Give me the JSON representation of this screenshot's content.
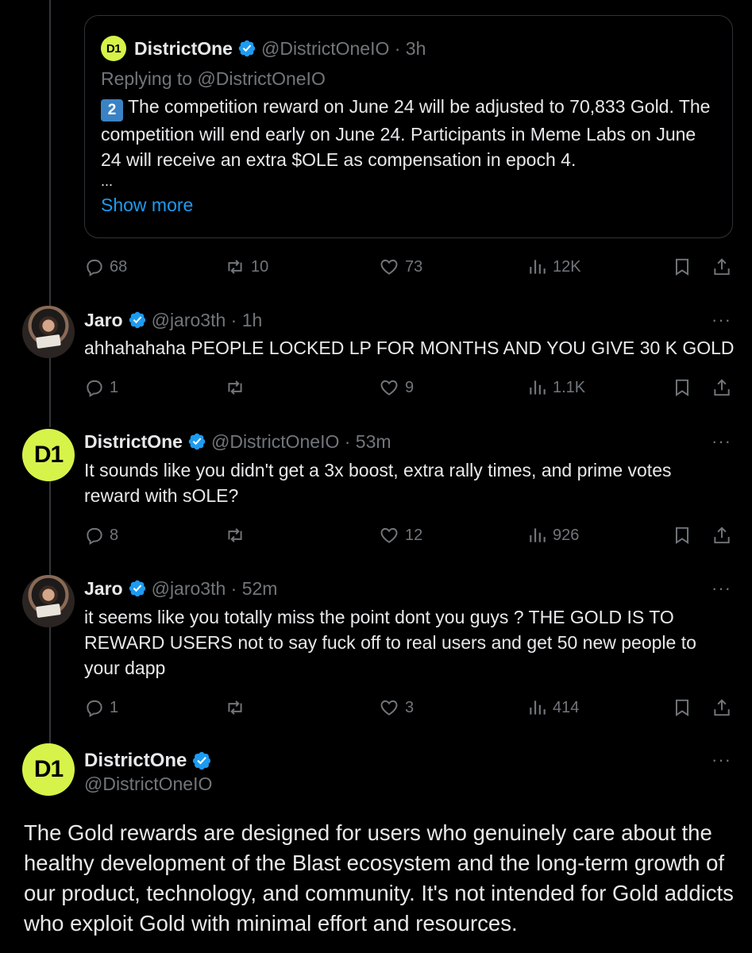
{
  "quoted_post": {
    "name": "DistrictOne",
    "handle_time": "@DistrictOneIO · 3h",
    "logo_text": "D1",
    "replying": "Replying to @DistrictOneIO",
    "badge": "2",
    "text": "The competition reward on June 24 will be adjusted to 70,833 Gold. The competition will end early on June 24. Participants in Meme Labs on June 24 will receive an extra $OLE as compensation in epoch 4.",
    "ellipsis": "...",
    "show_more": "Show more",
    "replies": "68",
    "reposts": "10",
    "likes": "73",
    "views": "12K"
  },
  "posts": [
    {
      "name": "Jaro",
      "handle_time": "@jaro3th · 1h",
      "text": "ahhahahaha PEOPLE LOCKED LP FOR MONTHS AND YOU GIVE 30 K GOLD",
      "replies": "1",
      "reposts": "",
      "likes": "9",
      "views": "1.1K"
    },
    {
      "name": "DistrictOne",
      "handle_time": "@DistrictOneIO · 53m",
      "logo_text": "D1",
      "text": "It sounds like you didn't get a 3x boost, extra rally times, and prime votes reward with sOLE?",
      "replies": "8",
      "reposts": "",
      "likes": "12",
      "views": "926"
    },
    {
      "name": "Jaro",
      "handle_time": "@jaro3th · 52m",
      "text": "it seems like you totally miss the point dont you guys ? THE GOLD IS TO REWARD USERS not to say fuck off to real users and get 50 new people to your dapp",
      "replies": "1",
      "reposts": "",
      "likes": "3",
      "views": "414"
    }
  ],
  "main_post": {
    "name": "DistrictOne",
    "handle": "@DistrictOneIO",
    "logo_text": "D1",
    "text": "The Gold rewards are designed for users who genuinely care about the healthy development of the Blast ecosystem and the long-term growth of our product, technology, and community. It's not intended for Gold addicts who exploit Gold with minimal effort and resources."
  },
  "more_label": "···",
  "colors": {
    "background": "#000000",
    "text": "#e7e9ea",
    "muted": "#71767b",
    "link": "#1d9bf0",
    "verified": "#1d9bf0",
    "brand": "#d6f34a"
  },
  "icons": [
    "reply-icon",
    "repost-icon",
    "like-icon",
    "views-icon",
    "bookmark-icon",
    "share-icon",
    "verified-icon",
    "more-icon"
  ]
}
